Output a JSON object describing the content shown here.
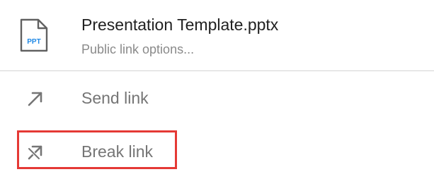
{
  "file": {
    "icon": "ppt-file-icon",
    "icon_badge": "PPT",
    "name": "Presentation Template.pptx",
    "subtitle": "Public link options..."
  },
  "menu": {
    "items": [
      {
        "label": "Send link",
        "icon": "arrow-up-right-icon"
      },
      {
        "label": "Break link",
        "icon": "broken-link-arrow-icon"
      }
    ]
  },
  "colors": {
    "title_text": "#212121",
    "subtitle_text": "#8a8a8a",
    "menu_text": "#757575",
    "icon_gray": "#757575",
    "ppt_badge_blue": "#1e88e5",
    "divider": "#d4d4d4",
    "highlight_red": "#e53935"
  }
}
